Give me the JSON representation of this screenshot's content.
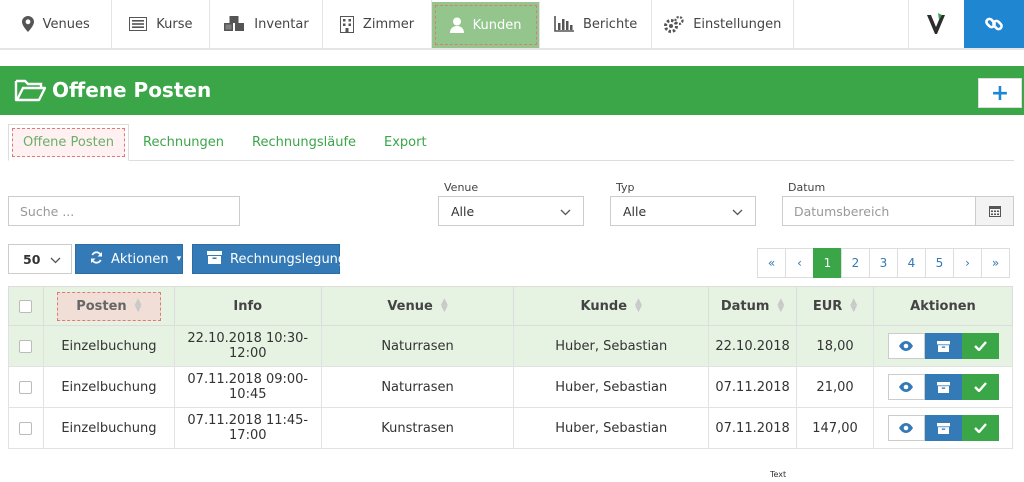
{
  "nav": {
    "items": [
      {
        "label": "Venues",
        "icon": "map-marker-icon"
      },
      {
        "label": "Kurse",
        "icon": "list-icon"
      },
      {
        "label": "Inventar",
        "icon": "cubes-icon"
      },
      {
        "label": "Zimmer",
        "icon": "building-icon"
      },
      {
        "label": "Kunden",
        "icon": "user-icon"
      },
      {
        "label": "Berichte",
        "icon": "bar-chart-icon"
      },
      {
        "label": "Einstellungen",
        "icon": "gears-icon"
      }
    ],
    "active": "Kunden"
  },
  "header": {
    "title": "Offene Posten",
    "add_label": "+"
  },
  "tabs": [
    "Offene Posten",
    "Rechnungen",
    "Rechnungsläufe",
    "Export"
  ],
  "filters": {
    "search_placeholder": "Suche ...",
    "venue_label": "Venue",
    "venue_value": "Alle",
    "typ_label": "Typ",
    "typ_value": "Alle",
    "datum_label": "Datum",
    "datum_placeholder": "Datumsbereich"
  },
  "toolbar": {
    "per_page": "50",
    "aktionen_label": "Aktionen",
    "rechnung_label": "Rechnungslegung"
  },
  "pagination": {
    "first": "«",
    "prev": "‹",
    "pages": [
      "1",
      "2",
      "3",
      "4",
      "5"
    ],
    "next": "›",
    "last": "»",
    "current": "1"
  },
  "table": {
    "columns": [
      "Posten",
      "Info",
      "Venue",
      "Kunde",
      "Datum",
      "EUR",
      "Aktionen"
    ],
    "rows": [
      {
        "posten": "Einzelbuchung",
        "info": "22.10.2018 10:30-12:00",
        "venue": "Naturrasen",
        "kunde": "Huber, Sebastian",
        "datum": "22.10.2018",
        "eur": "18,00"
      },
      {
        "posten": "Einzelbuchung",
        "info": "07.11.2018 09:00-10:45",
        "venue": "Naturrasen",
        "kunde": "Huber, Sebastian",
        "datum": "07.11.2018",
        "eur": "21,00"
      },
      {
        "posten": "Einzelbuchung",
        "info": "07.11.2018 11:45-17:00",
        "venue": "Kunstrasen",
        "kunde": "Huber, Sebastian",
        "datum": "07.11.2018",
        "eur": "147,00"
      }
    ]
  },
  "footer_text": "Text",
  "colors": {
    "green": "#3aa648",
    "light_green": "#e6f3e3",
    "blue": "#337ab7",
    "nav_blue": "#1f86d2"
  }
}
